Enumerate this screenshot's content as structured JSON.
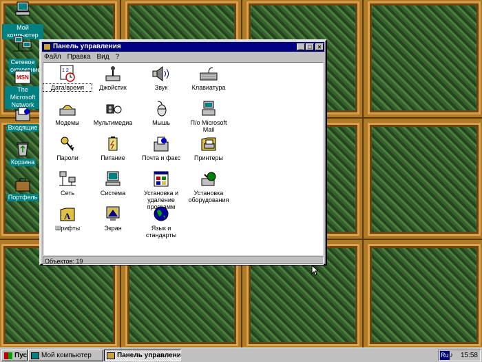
{
  "desktop": {
    "icons": [
      {
        "label": "Мой компьютер",
        "icon": "my-computer-icon"
      },
      {
        "label": "Сетевое окружение",
        "icon": "network-icon"
      },
      {
        "label": "The Microsoft Network",
        "icon": "msn-icon"
      },
      {
        "label": "Входящие",
        "icon": "inbox-icon"
      },
      {
        "label": "Корзина",
        "icon": "recycle-bin-icon"
      },
      {
        "label": "Портфель",
        "icon": "briefcase-icon"
      }
    ]
  },
  "window": {
    "title": "Панель управления",
    "menu": [
      {
        "label": "Файл"
      },
      {
        "label": "Правка"
      },
      {
        "label": "Вид"
      },
      {
        "label": "?"
      }
    ],
    "items": [
      {
        "label": "Дата/время",
        "icon": "date-time-icon"
      },
      {
        "label": "Джойстик",
        "icon": "joystick-icon"
      },
      {
        "label": "Звук",
        "icon": "sound-icon"
      },
      {
        "label": "Клавиатура",
        "icon": "keyboard-icon"
      },
      {
        "label": "Модемы",
        "icon": "modem-icon"
      },
      {
        "label": "Мультимедиа",
        "icon": "multimedia-icon"
      },
      {
        "label": "Мышь",
        "icon": "mouse-icon"
      },
      {
        "label": "П/о Microsoft Mail",
        "icon": "mail-icon"
      },
      {
        "label": "Пароли",
        "icon": "passwords-icon"
      },
      {
        "label": "Питание",
        "icon": "power-icon"
      },
      {
        "label": "Почта и факс",
        "icon": "mail-fax-icon"
      },
      {
        "label": "Принтеры",
        "icon": "printers-icon"
      },
      {
        "label": "Сеть",
        "icon": "network-icon"
      },
      {
        "label": "Система",
        "icon": "system-icon"
      },
      {
        "label": "Установка и удаление программ",
        "icon": "add-remove-programs-icon"
      },
      {
        "label": "Установка оборудования",
        "icon": "add-hardware-icon"
      },
      {
        "label": "Шрифты",
        "icon": "fonts-icon"
      },
      {
        "label": "Экран",
        "icon": "display-icon"
      },
      {
        "label": "Язык и стандарты",
        "icon": "regional-settings-icon"
      }
    ],
    "status": "Объектов: 19"
  },
  "taskbar": {
    "start_label": "Пуск",
    "tasks": [
      {
        "label": "Мой компьютер"
      },
      {
        "label": "Панель управления"
      }
    ],
    "tray": {
      "lang": "Ru",
      "time": "15:58"
    }
  },
  "colors": {
    "titlebar": "#000080",
    "desktop_label_bg": "#008080",
    "window_face": "#c0c0c0"
  }
}
